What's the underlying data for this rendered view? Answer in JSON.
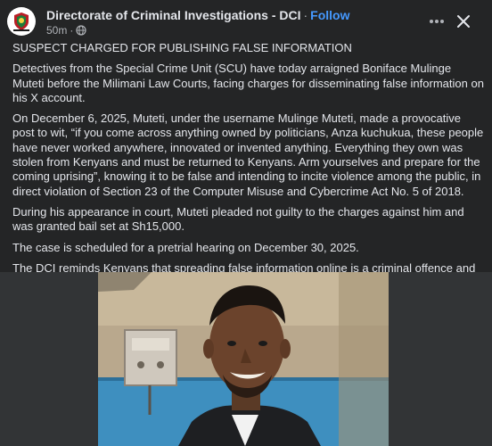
{
  "header": {
    "page_name": "Directorate of Criminal Investigations - DCI",
    "separator": "·",
    "follow_label": "Follow",
    "timestamp": "50m",
    "meta_separator": "·",
    "privacy_icon": "globe-icon",
    "more_icon": "more-horizontal-icon",
    "close_icon": "close-icon"
  },
  "post": {
    "paragraphs": [
      "SUSPECT CHARGED FOR PUBLISHING FALSE INFORMATION",
      "Detectives from the Special Crime Unit (SCU) have today arraigned Boniface Mulinge Muteti before the Milimani Law Courts, facing charges for disseminating false information on his X account.",
      "On December 6, 2025, Muteti, under the username Mulinge Muteti, made a provocative post to wit, “if you come across anything owned by politicians, Anza kuchukua, these people have never worked anywhere, innovated or invented anything. Everything they own was stolen from Kenyans and must be returned to Kenyans. Arm yourselves and prepare for the coming uprising”, knowing it to be false and intending to incite violence among the public, in direct violation of Section 23 of the Computer Misuse and Cybercrime Act No. 5 of 2018.",
      "During his appearance in court, Muteti pleaded not guilty to the charges against him and was granted bail set at Sh15,000.",
      "The case is scheduled for a pretrial hearing on December 30, 2025.",
      "The DCI reminds Kenyans that spreading false information online is a criminal offence and urges responsible use of social media."
    ]
  },
  "colors": {
    "background": "#242526",
    "text": "#e4e6eb",
    "secondary_text": "#b0b3b8",
    "follow_link": "#4599ff"
  }
}
